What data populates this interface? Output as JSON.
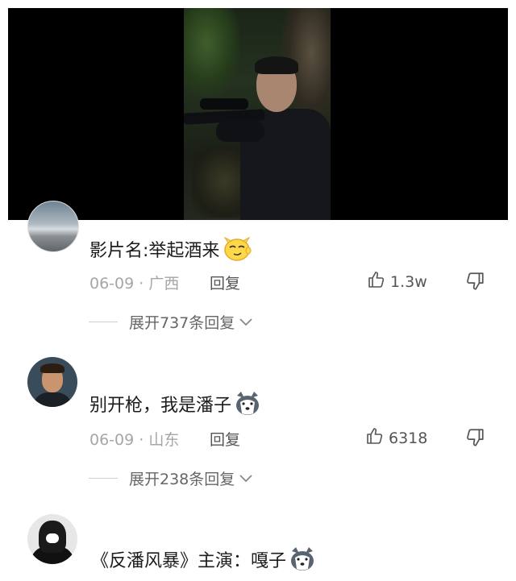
{
  "video": {
    "icon": "video-frame"
  },
  "comments": [
    {
      "text": "影片名:举起酒来",
      "emoji": "smug-face-emoji",
      "date": "06-09",
      "sep": " · ",
      "location": "广西",
      "reply_label": "回复",
      "likes": "1.3w",
      "expand_label": "展开737条回复"
    },
    {
      "text": "别开枪，我是潘子",
      "emoji": "husky-dog-emoji",
      "date": "06-09",
      "sep": " · ",
      "location": "山东",
      "reply_label": "回复",
      "likes": "6318",
      "expand_label": "展开238条回复"
    },
    {
      "text": "《反潘风暴》主演：嘎子",
      "emoji": "husky-dog-emoji"
    }
  ],
  "colors": {
    "text": "#1c1c1c",
    "meta": "#a6a6a6",
    "action": "#555555"
  }
}
